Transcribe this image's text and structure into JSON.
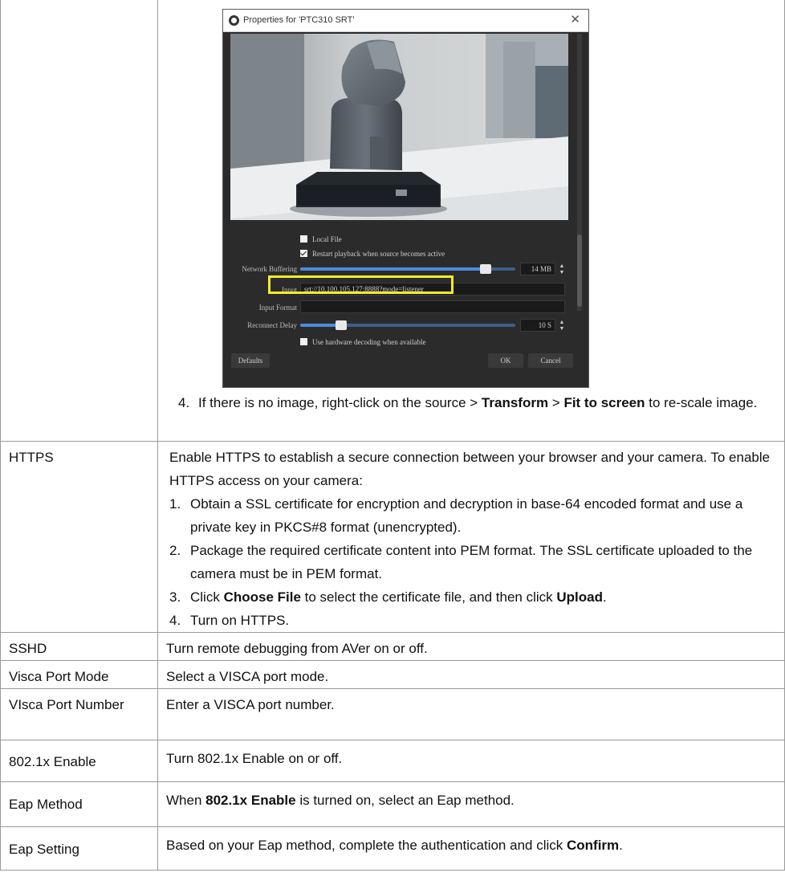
{
  "dialog": {
    "title": "Properties for 'PTC310 SRT'",
    "close_icon": "close-icon",
    "local_file_label": "Local File",
    "local_file_checked": false,
    "restart_label": "Restart playback when source becomes active",
    "restart_checked": true,
    "network_buffering_label": "Network Buffering",
    "network_buffering_value": "14 MB",
    "input_label": "Input",
    "input_value": "srt://10.100.105.127:8888?mode=listener",
    "input_format_label": "Input Format",
    "reconnect_delay_label": "Reconnect Delay",
    "reconnect_delay_value": "10 S",
    "hw_decoding_label": "Use hardware decoding when available",
    "hw_decoding_checked": false,
    "defaults_button": "Defaults",
    "ok_button": "OK",
    "cancel_button": "Cancel"
  },
  "step4": {
    "number": "4.",
    "text_before": "If there is no image, right-click on the source > ",
    "transform": "Transform",
    "separator": " > ",
    "fit": "Fit to screen",
    "text_after": " to re-scale image."
  },
  "rows": {
    "https": {
      "name": "HTTPS",
      "intro": "Enable HTTPS to establish a secure connection between your browser and your camera. To enable HTTPS access on your camera:",
      "s1_num": "1.",
      "s1_text": "Obtain a SSL certificate for encryption and decryption in base-64 encoded format and use a private key in PKCS#8 format (unencrypted).",
      "s2_num": "2.",
      "s2_text": "Package the required certificate content into PEM format. The SSL certificate uploaded to the camera must be in PEM format.",
      "s3_num": "3.",
      "s3_pre": "Click ",
      "s3_choose": "Choose File",
      "s3_mid": " to select the certificate file, and then click ",
      "s3_upload": "Upload",
      "s3_end": ".",
      "s4_num": "4.",
      "s4_text": "Turn on HTTPS."
    },
    "sshd": {
      "name": "SSHD",
      "desc": "Turn remote debugging from AVer on or off."
    },
    "visca_mode": {
      "name": "Visca Port Mode",
      "desc": "Select a VISCA port mode."
    },
    "visca_number": {
      "name": "VIsca Port Number",
      "desc": "Enter a VISCA port number."
    },
    "dot1x": {
      "name": "802.1x Enable",
      "desc": "Turn 802.1x Enable on or off."
    },
    "eap_method": {
      "name": "Eap Method",
      "desc_pre": "When ",
      "desc_bold": "802.1x Enable",
      "desc_post": " is turned on, select an Eap method."
    },
    "eap_setting": {
      "name": "Eap Setting",
      "desc_pre": "Based on your Eap method, complete the authentication and click ",
      "desc_bold": "Confirm",
      "desc_post": "."
    }
  }
}
